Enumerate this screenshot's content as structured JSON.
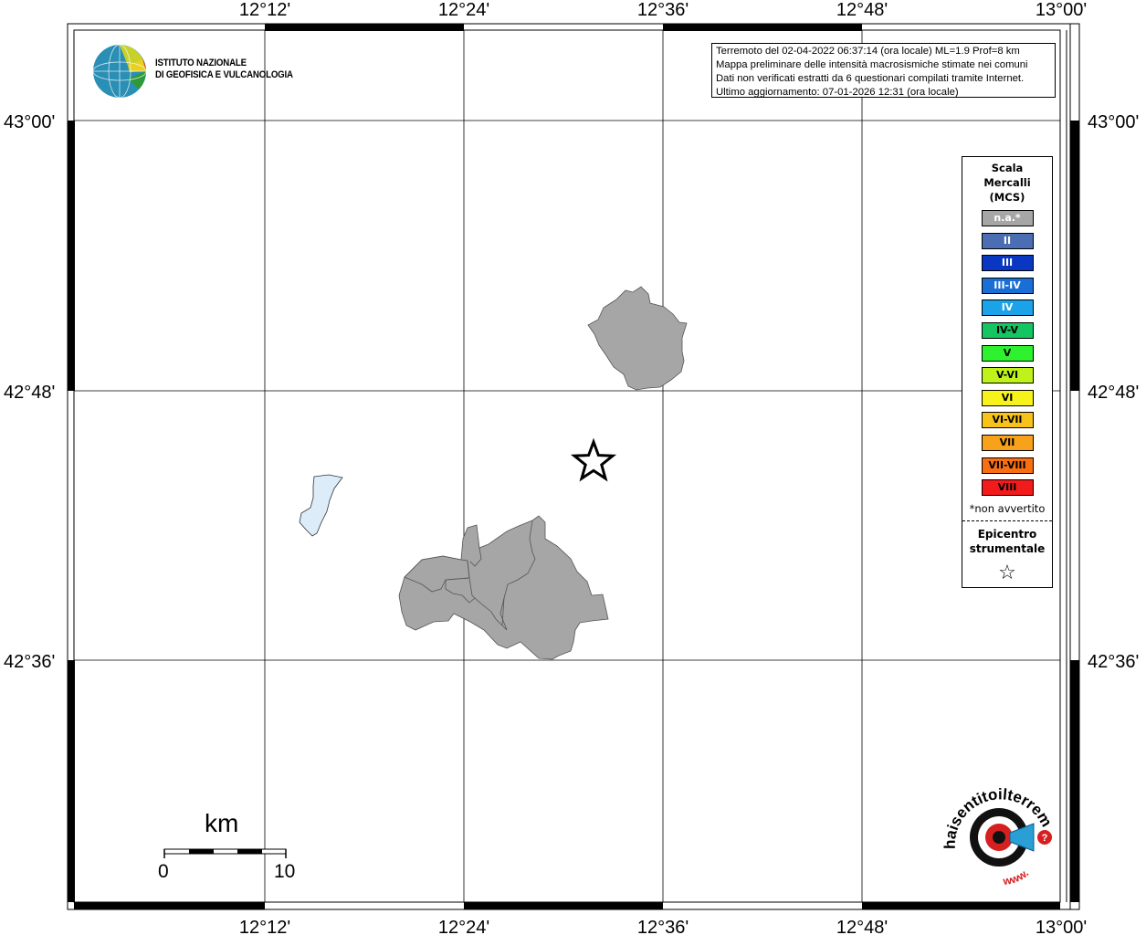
{
  "map": {
    "lon_labels": [
      "12°12'",
      "12°24'",
      "12°36'",
      "12°48'",
      "13°00'"
    ],
    "lat_labels": [
      "43°00'",
      "42°48'",
      "42°36'"
    ],
    "lakes_color": "#dcecf8",
    "municipality_color": "#a6a6a6",
    "epicenter_marker": "star-icon"
  },
  "logo": {
    "line1": "ISTITUTO NAZIONALE",
    "line2": "DI GEOFISICA E VULCANOLOGIA"
  },
  "info": {
    "line1": "Terremoto del 02-04-2022 06:37:14 (ora locale) ML=1.9 Prof=8 km",
    "line2": "Mappa preliminare delle intensità macrosismiche stimate nei comuni",
    "line3": "Dati non verificati estratti da 6 questionari compilati tramite Internet.",
    "line4": "Ultimo aggiornamento: 07-01-2026 12:31 (ora locale)"
  },
  "legend": {
    "title1": "Scala",
    "title2": "Mercalli",
    "title3": "(MCS)",
    "items": [
      {
        "label": "n.a.*",
        "color": "#a6a6a6",
        "text": "#ffffff"
      },
      {
        "label": "II",
        "color": "#4b6db3",
        "text": "#ffffff"
      },
      {
        "label": "III",
        "color": "#0a37c2",
        "text": "#ffffff"
      },
      {
        "label": "III-IV",
        "color": "#1a6fd6",
        "text": "#ffffff"
      },
      {
        "label": "IV",
        "color": "#1aa3e8",
        "text": "#ffffff"
      },
      {
        "label": "IV-V",
        "color": "#13c661",
        "text": "#000000"
      },
      {
        "label": "V",
        "color": "#2ef22e",
        "text": "#000000"
      },
      {
        "label": "V-VI",
        "color": "#bff21a",
        "text": "#000000"
      },
      {
        "label": "VI",
        "color": "#f7f21a",
        "text": "#000000"
      },
      {
        "label": "VI-VII",
        "color": "#f7c21a",
        "text": "#000000"
      },
      {
        "label": "VII",
        "color": "#f7a21a",
        "text": "#000000"
      },
      {
        "label": "VII-VIII",
        "color": "#f76f12",
        "text": "#000000"
      },
      {
        "label": "VIII",
        "color": "#f21a1a",
        "text": "#000000"
      }
    ],
    "note": "*non avvertito",
    "epi1": "Epicentro",
    "epi2": "strumentale",
    "star": "☆"
  },
  "scale": {
    "title": "km",
    "left": "0",
    "right": "10"
  },
  "hsi_logo": {
    "text": "haisentitoilterremoto.it",
    "prefix": "www."
  }
}
